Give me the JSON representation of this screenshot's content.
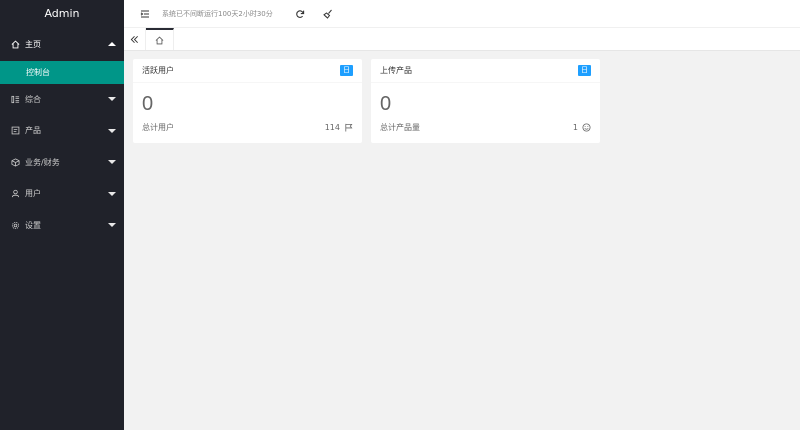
{
  "sidebar": {
    "logo": "Admin",
    "home": {
      "label": "主页",
      "icon": "home-icon"
    },
    "home_sub": {
      "label": "控制台"
    },
    "items": [
      {
        "label": "综合",
        "icon": "grid-icon"
      },
      {
        "label": "产品",
        "icon": "product-icon"
      },
      {
        "label": "业务/财务",
        "icon": "finance-icon"
      },
      {
        "label": "用户",
        "icon": "user-icon"
      },
      {
        "label": "设置",
        "icon": "gear-icon"
      }
    ]
  },
  "header": {
    "status_text": "系统已不间断运行100天2小时30分"
  },
  "cards": [
    {
      "title": "活跃用户",
      "badge": "日",
      "value": "0",
      "foot_label": "总计用户",
      "foot_value": "114",
      "foot_icon": "flag-icon"
    },
    {
      "title": "上传产品",
      "badge": "日",
      "value": "0",
      "foot_label": "总计产品量",
      "foot_value": "1",
      "foot_icon": "smile-icon"
    }
  ],
  "colors": {
    "sidebar_bg": "#20222a",
    "accent": "#009688",
    "badge": "#1e9fff"
  }
}
